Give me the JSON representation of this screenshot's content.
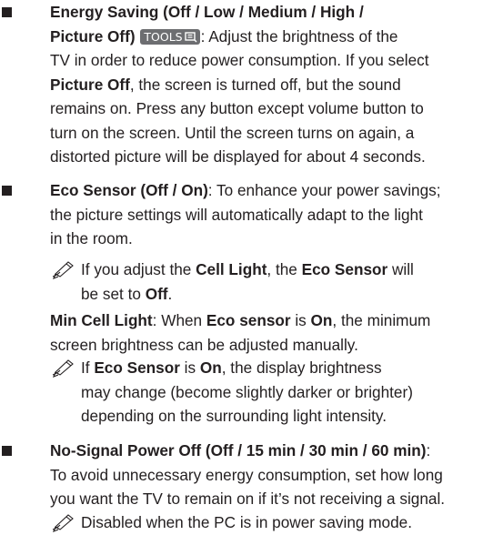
{
  "energy_saving": {
    "heading_line1": "Energy Saving (Off / Low / Medium / High /",
    "heading_line2": "Picture Off)",
    "tools_badge": "TOOLS",
    "line2_rest": ": Adjust the brightness of the",
    "line3": "TV in order to reduce power consumption. If you select",
    "line4_bold": "Picture Off",
    "line4_rest": ", the screen is turned off, but the sound",
    "line5": "remains on. Press any button except volume button to",
    "line6": "turn on the screen. Until the screen turns on again, a",
    "line7": "distorted picture will be displayed for about 4 seconds."
  },
  "eco_sensor": {
    "heading": "Eco Sensor (Off / On)",
    "line1_rest": ": To enhance your power savings;",
    "line2": "the picture settings will automatically adapt to the light",
    "line3": "in the room.",
    "note_prefix": "If you adjust the ",
    "note_bold1": "Cell Light",
    "note_mid": ", the ",
    "note_bold2": "Eco Sensor",
    "note_suffix": " will",
    "note_line2_prefix": "be set to ",
    "note_line2_bold": "Off",
    "note_line2_suffix": "."
  },
  "min_cell_light": {
    "heading": "Min Cell Light",
    "t1": ": When ",
    "b1": "Eco sensor",
    "t2": " is ",
    "b2": "On",
    "t3": ", the minimum",
    "line2": "screen brightness can be adjusted manually.",
    "note_t1": "If ",
    "note_b1": "Eco Sensor",
    "note_t2": " is ",
    "note_b2": "On",
    "note_t3": ", the display brightness",
    "note_line2": "may change (become slightly darker or brighter)",
    "note_line3": "depending on the surrounding light intensity."
  },
  "no_signal": {
    "heading": "No-Signal Power Off (Off / 15 min / 30 min / 60 min)",
    "heading_colon": ":",
    "line2": "To avoid unnecessary energy consumption, set how long",
    "line3": "you want the TV to remain on if it’s not receiving a signal.",
    "note": "Disabled when the PC is in power saving mode."
  },
  "icons": {
    "bullet": "square-bullet-icon",
    "note": "note-pencil-icon",
    "tools": "tools-remote-icon"
  },
  "colors": {
    "text": "#231f20",
    "tools_badge_bg": "#6d6e71"
  }
}
